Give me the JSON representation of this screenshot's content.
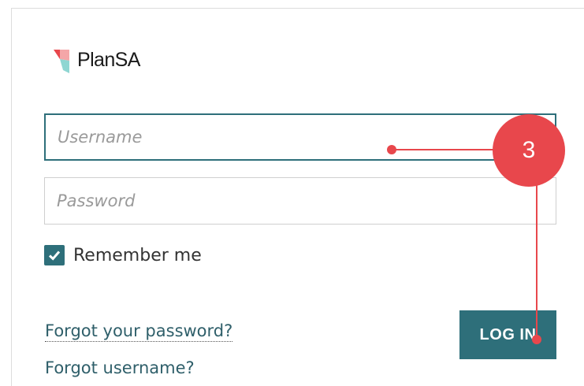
{
  "brand": {
    "name": "PlanSA",
    "logo_icon": "plansa-logo-icon"
  },
  "form": {
    "username_placeholder": "Username",
    "password_placeholder": "Password",
    "remember_label": "Remember me",
    "remember_checked": true,
    "forgot_password": "Forgot your password?",
    "forgot_username": "Forgot username?",
    "login_label": "LOG IN"
  },
  "annotation": {
    "step_number": "3"
  },
  "colors": {
    "accent": "#2e6f7a",
    "callout": "#e8474c"
  }
}
